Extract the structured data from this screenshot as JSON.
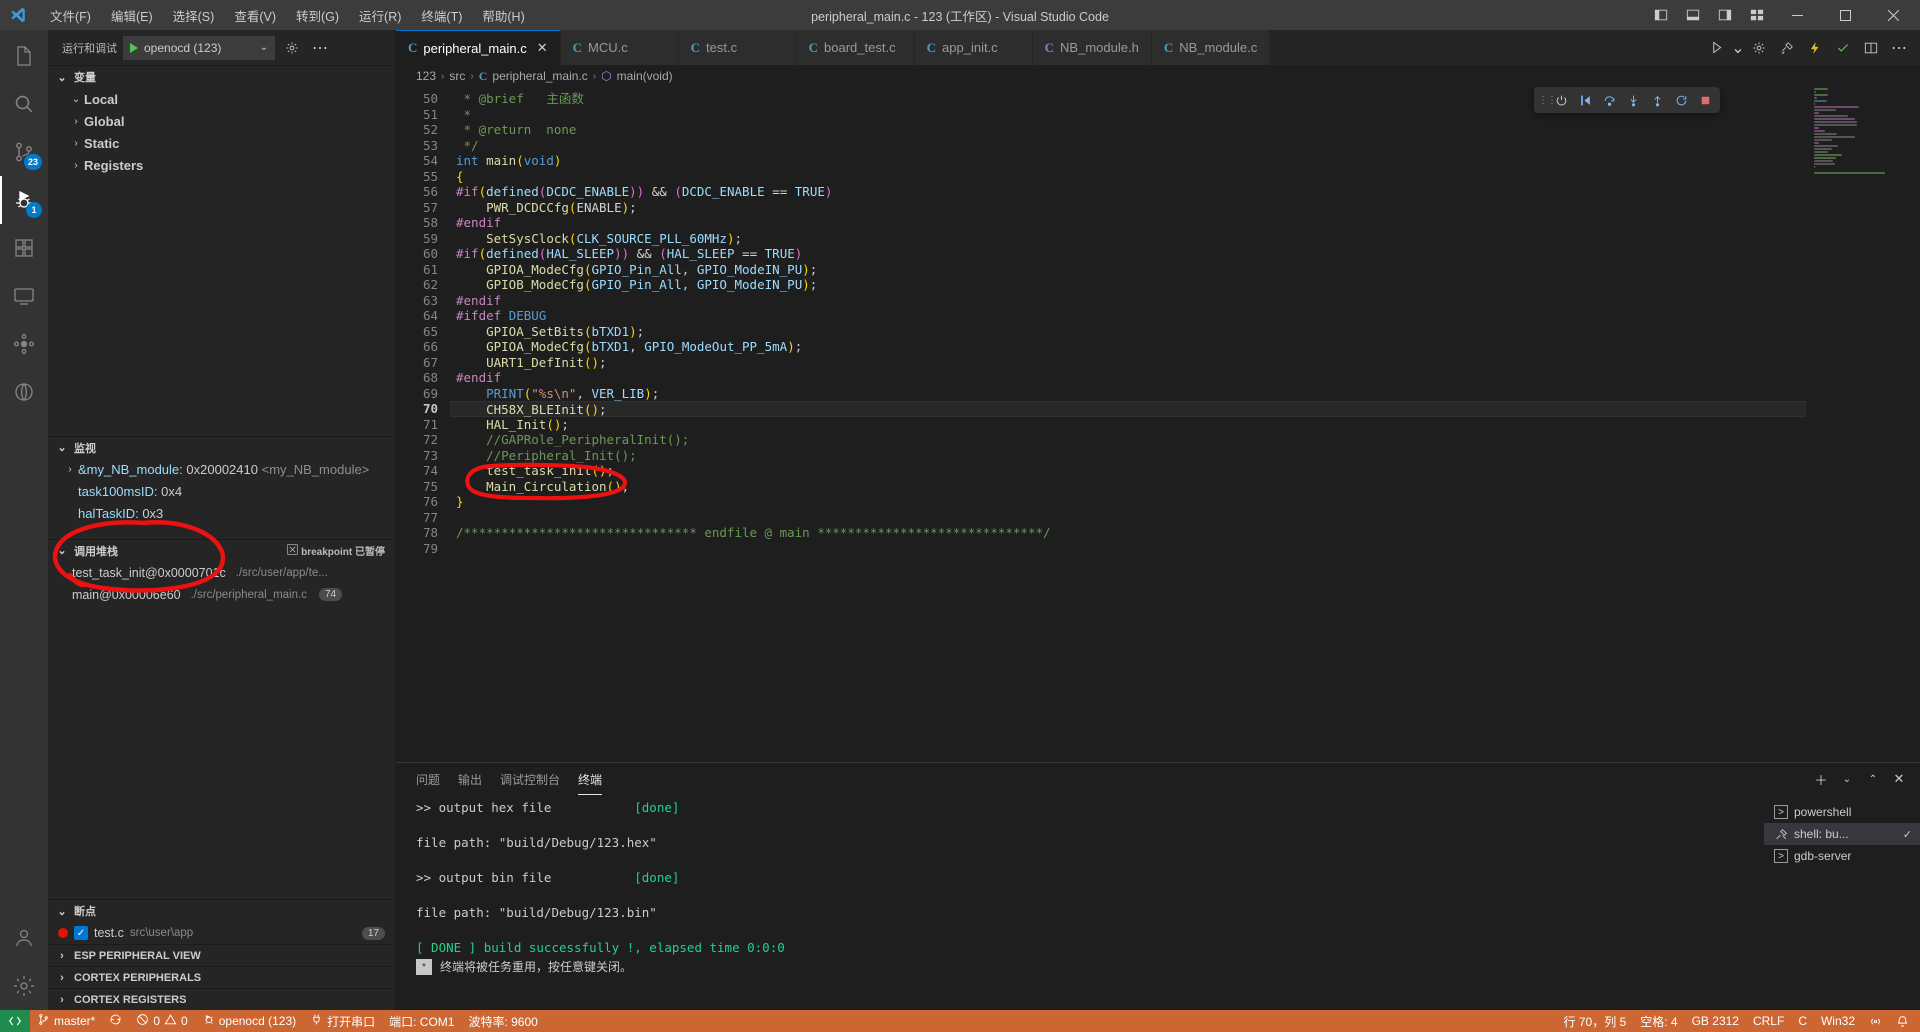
{
  "titlebar": {
    "window_title": "peripheral_main.c - 123 (工作区) - Visual Studio Code",
    "menus": [
      "文件(F)",
      "编辑(E)",
      "选择(S)",
      "查看(V)",
      "转到(G)",
      "运行(R)",
      "终端(T)",
      "帮助(H)"
    ],
    "layout_icons": [
      "panel-left-icon",
      "panel-bottom-icon",
      "panel-right-icon",
      "customize-layout-icon"
    ],
    "window_buttons": [
      "minimize",
      "maximize",
      "close"
    ]
  },
  "activitybar": {
    "items": [
      {
        "name": "explorer",
        "badge": ""
      },
      {
        "name": "search",
        "badge": ""
      },
      {
        "name": "source-control",
        "badge": "23"
      },
      {
        "name": "run-and-debug",
        "badge": "1"
      },
      {
        "name": "extensions",
        "badge": ""
      },
      {
        "name": "remote-explorer",
        "badge": ""
      },
      {
        "name": "testing",
        "badge": ""
      },
      {
        "name": "embedded-ide",
        "badge": ""
      }
    ],
    "bottom": [
      {
        "name": "accounts"
      },
      {
        "name": "settings"
      }
    ]
  },
  "sidebar": {
    "header_title": "运行和调试",
    "config_name": "openocd (123)",
    "gear_icon": "gear-icon",
    "more_icon": "ellipsis-icon",
    "variables": {
      "title": "变量",
      "items": [
        {
          "label": "Local",
          "expanded": true
        },
        {
          "label": "Global",
          "expanded": false
        },
        {
          "label": "Static",
          "expanded": false
        },
        {
          "label": "Registers",
          "expanded": false
        }
      ]
    },
    "watch": {
      "title": "监视",
      "items": [
        {
          "expandable": true,
          "name": "&my_NB_module:",
          "value": "0x20002410",
          "symbol": "<my_NB_module>"
        },
        {
          "expandable": false,
          "name": "task100msID:",
          "value": "0x4",
          "symbol": ""
        },
        {
          "expandable": false,
          "name": "halTaskID:",
          "value": "0x3",
          "symbol": ""
        }
      ]
    },
    "callstack": {
      "title": "调用堆栈",
      "status": "breakpoint 已暂停",
      "status_icon": "pause-icon",
      "frames": [
        {
          "name": "test_task_init@0x0000701c",
          "path": "./src/user/app/te...",
          "line": ""
        },
        {
          "name": "main@0x00006e60",
          "path": "./src/peripheral_main.c",
          "line": "74"
        }
      ]
    },
    "breakpoints": {
      "title": "断点",
      "items": [
        {
          "file": "test.c",
          "path": "src\\user\\app",
          "line": "17",
          "enabled": true
        }
      ]
    },
    "collapsed_panes": [
      "ESP PERIPHERAL VIEW",
      "CORTEX PERIPHERALS",
      "CORTEX REGISTERS"
    ]
  },
  "editor": {
    "tabs": [
      {
        "label": "peripheral_main.c",
        "icon": "c-file-icon",
        "active": true,
        "closable": true,
        "icon_color": "blue"
      },
      {
        "label": "MCU.c",
        "icon": "c-file-icon",
        "active": false,
        "icon_color": "blue"
      },
      {
        "label": "test.c",
        "icon": "c-file-icon",
        "active": false,
        "icon_color": "blue"
      },
      {
        "label": "board_test.c",
        "icon": "c-file-icon",
        "active": false,
        "icon_color": "blue"
      },
      {
        "label": "app_init.c",
        "icon": "c-file-icon",
        "active": false,
        "icon_color": "blue"
      },
      {
        "label": "NB_module.h",
        "icon": "c-file-icon",
        "active": false,
        "icon_color": "purple"
      },
      {
        "label": "NB_module.c",
        "icon": "c-file-icon",
        "active": false,
        "icon_color": "blue"
      }
    ],
    "tab_actions": [
      "run-debug-icon",
      "gear-icon",
      "build-icon",
      "flash-icon",
      "check-icon",
      "split-editor-icon",
      "more-actions-icon"
    ],
    "breadcrumb": [
      "123",
      "src",
      "peripheral_main.c",
      "main(void)"
    ],
    "first_line_number": 50,
    "current_line": 70,
    "lines": [
      {
        "n": 50,
        "tokens": [
          {
            "t": " * @brief   ",
            "c": "c-cmt"
          },
          {
            "t": "主函数",
            "c": "c-cmt"
          }
        ]
      },
      {
        "n": 51,
        "tokens": [
          {
            "t": " *",
            "c": "c-cmt"
          }
        ]
      },
      {
        "n": 52,
        "tokens": [
          {
            "t": " * @return  none",
            "c": "c-cmt"
          }
        ]
      },
      {
        "n": 53,
        "tokens": [
          {
            "t": " */",
            "c": "c-cmt"
          }
        ]
      },
      {
        "n": 54,
        "tokens": [
          {
            "t": "int",
            "c": "c-kw"
          },
          {
            "t": " ",
            "c": "c-plain"
          },
          {
            "t": "main",
            "c": "c-fn"
          },
          {
            "t": "(",
            "c": "c-br1"
          },
          {
            "t": "void",
            "c": "c-kw"
          },
          {
            "t": ")",
            "c": "c-br1"
          }
        ]
      },
      {
        "n": 55,
        "tokens": [
          {
            "t": "{",
            "c": "c-br1"
          }
        ]
      },
      {
        "n": 56,
        "tokens": [
          {
            "t": "#if",
            "c": "c-kw2"
          },
          {
            "t": "(",
            "c": "c-br1"
          },
          {
            "t": "defined",
            "c": "c-id"
          },
          {
            "t": "(",
            "c": "c-br2"
          },
          {
            "t": "DCDC_ENABLE",
            "c": "c-id"
          },
          {
            "t": "))",
            "c": "c-br2"
          },
          {
            "t": " ",
            "c": "c-plain"
          },
          {
            "t": "&&",
            "c": "c-op"
          },
          {
            "t": " ",
            "c": "c-plain"
          },
          {
            "t": "(",
            "c": "c-br2"
          },
          {
            "t": "DCDC_ENABLE",
            "c": "c-id"
          },
          {
            "t": " ",
            "c": "c-plain"
          },
          {
            "t": "==",
            "c": "c-op"
          },
          {
            "t": " ",
            "c": "c-plain"
          },
          {
            "t": "TRUE",
            "c": "c-id"
          },
          {
            "t": ")",
            "c": "c-br2"
          }
        ]
      },
      {
        "n": 57,
        "tokens": [
          {
            "t": "    ",
            "c": "c-plain"
          },
          {
            "t": "PWR_DCDCCfg",
            "c": "c-fn"
          },
          {
            "t": "(",
            "c": "c-br1"
          },
          {
            "t": "ENABLE",
            "c": "c-plain"
          },
          {
            "t": ")",
            "c": "c-br1"
          },
          {
            "t": ";",
            "c": "c-pun"
          }
        ]
      },
      {
        "n": 58,
        "tokens": [
          {
            "t": "#endif",
            "c": "c-kw2"
          }
        ]
      },
      {
        "n": 59,
        "tokens": [
          {
            "t": "    ",
            "c": "c-plain"
          },
          {
            "t": "SetSysClock",
            "c": "c-fn"
          },
          {
            "t": "(",
            "c": "c-br1"
          },
          {
            "t": "CLK_SOURCE_PLL_60MHz",
            "c": "c-id"
          },
          {
            "t": ")",
            "c": "c-br1"
          },
          {
            "t": ";",
            "c": "c-pun"
          }
        ]
      },
      {
        "n": 60,
        "tokens": [
          {
            "t": "#if",
            "c": "c-kw2"
          },
          {
            "t": "(",
            "c": "c-br1"
          },
          {
            "t": "defined",
            "c": "c-id"
          },
          {
            "t": "(",
            "c": "c-br2"
          },
          {
            "t": "HAL_SLEEP",
            "c": "c-id"
          },
          {
            "t": "))",
            "c": "c-br2"
          },
          {
            "t": " ",
            "c": "c-plain"
          },
          {
            "t": "&&",
            "c": "c-op"
          },
          {
            "t": " ",
            "c": "c-plain"
          },
          {
            "t": "(",
            "c": "c-br2"
          },
          {
            "t": "HAL_SLEEP",
            "c": "c-id"
          },
          {
            "t": " ",
            "c": "c-plain"
          },
          {
            "t": "==",
            "c": "c-op"
          },
          {
            "t": " ",
            "c": "c-plain"
          },
          {
            "t": "TRUE",
            "c": "c-id"
          },
          {
            "t": ")",
            "c": "c-br2"
          }
        ]
      },
      {
        "n": 61,
        "tokens": [
          {
            "t": "    ",
            "c": "c-plain"
          },
          {
            "t": "GPIOA_ModeCfg",
            "c": "c-fn"
          },
          {
            "t": "(",
            "c": "c-br1"
          },
          {
            "t": "GPIO_Pin_All",
            "c": "c-id"
          },
          {
            "t": ", ",
            "c": "c-pun"
          },
          {
            "t": "GPIO_ModeIN_PU",
            "c": "c-id"
          },
          {
            "t": ")",
            "c": "c-br1"
          },
          {
            "t": ";",
            "c": "c-pun"
          }
        ]
      },
      {
        "n": 62,
        "tokens": [
          {
            "t": "    ",
            "c": "c-plain"
          },
          {
            "t": "GPIOB_ModeCfg",
            "c": "c-fn"
          },
          {
            "t": "(",
            "c": "c-br1"
          },
          {
            "t": "GPIO_Pin_All",
            "c": "c-id"
          },
          {
            "t": ", ",
            "c": "c-pun"
          },
          {
            "t": "GPIO_ModeIN_PU",
            "c": "c-id"
          },
          {
            "t": ")",
            "c": "c-br1"
          },
          {
            "t": ";",
            "c": "c-pun"
          }
        ]
      },
      {
        "n": 63,
        "tokens": [
          {
            "t": "#endif",
            "c": "c-kw2"
          }
        ]
      },
      {
        "n": 64,
        "tokens": [
          {
            "t": "#ifdef",
            "c": "c-kw2"
          },
          {
            "t": " ",
            "c": "c-plain"
          },
          {
            "t": "DEBUG",
            "c": "c-kw"
          }
        ]
      },
      {
        "n": 65,
        "tokens": [
          {
            "t": "    ",
            "c": "c-plain"
          },
          {
            "t": "GPIOA_SetBits",
            "c": "c-fn"
          },
          {
            "t": "(",
            "c": "c-br1"
          },
          {
            "t": "bTXD1",
            "c": "c-id"
          },
          {
            "t": ")",
            "c": "c-br1"
          },
          {
            "t": ";",
            "c": "c-pun"
          }
        ]
      },
      {
        "n": 66,
        "tokens": [
          {
            "t": "    ",
            "c": "c-plain"
          },
          {
            "t": "GPIOA_ModeCfg",
            "c": "c-fn"
          },
          {
            "t": "(",
            "c": "c-br1"
          },
          {
            "t": "bTXD1",
            "c": "c-id"
          },
          {
            "t": ", ",
            "c": "c-pun"
          },
          {
            "t": "GPIO_ModeOut_PP_5mA",
            "c": "c-id"
          },
          {
            "t": ")",
            "c": "c-br1"
          },
          {
            "t": ";",
            "c": "c-pun"
          }
        ]
      },
      {
        "n": 67,
        "tokens": [
          {
            "t": "    ",
            "c": "c-plain"
          },
          {
            "t": "UART1_DefInit",
            "c": "c-fn"
          },
          {
            "t": "(",
            "c": "c-br1"
          },
          {
            "t": ")",
            "c": "c-br1"
          },
          {
            "t": ";",
            "c": "c-pun"
          }
        ]
      },
      {
        "n": 68,
        "tokens": [
          {
            "t": "#endif",
            "c": "c-kw2"
          }
        ]
      },
      {
        "n": 69,
        "tokens": [
          {
            "t": "    ",
            "c": "c-plain"
          },
          {
            "t": "PRINT",
            "c": "c-kw"
          },
          {
            "t": "(",
            "c": "c-br1"
          },
          {
            "t": "\"%s\\n\"",
            "c": "c-str"
          },
          {
            "t": ", ",
            "c": "c-pun"
          },
          {
            "t": "VER_LIB",
            "c": "c-id"
          },
          {
            "t": ")",
            "c": "c-br1"
          },
          {
            "t": ";",
            "c": "c-pun"
          }
        ]
      },
      {
        "n": 70,
        "tokens": [
          {
            "t": "    ",
            "c": "c-plain"
          },
          {
            "t": "CH58X_BLEInit",
            "c": "c-fn"
          },
          {
            "t": "(",
            "c": "c-br1"
          },
          {
            "t": ")",
            "c": "c-br1"
          },
          {
            "t": ";",
            "c": "c-pun"
          }
        ]
      },
      {
        "n": 71,
        "tokens": [
          {
            "t": "    ",
            "c": "c-plain"
          },
          {
            "t": "HAL_Init",
            "c": "c-fn"
          },
          {
            "t": "(",
            "c": "c-br1"
          },
          {
            "t": ")",
            "c": "c-br1"
          },
          {
            "t": ";",
            "c": "c-pun"
          }
        ]
      },
      {
        "n": 72,
        "tokens": [
          {
            "t": "    //GAPRole_PeripheralInit();",
            "c": "c-cmt"
          }
        ]
      },
      {
        "n": 73,
        "tokens": [
          {
            "t": "    //Peripheral_Init();",
            "c": "c-cmt"
          }
        ]
      },
      {
        "n": 74,
        "tokens": [
          {
            "t": "    ",
            "c": "c-plain"
          },
          {
            "t": "test_task_init",
            "c": "c-fn"
          },
          {
            "t": "(",
            "c": "c-br1"
          },
          {
            "t": ")",
            "c": "c-br1"
          },
          {
            "t": ";",
            "c": "c-pun"
          }
        ]
      },
      {
        "n": 75,
        "tokens": [
          {
            "t": "    ",
            "c": "c-plain"
          },
          {
            "t": "Main_Circulation",
            "c": "c-fn"
          },
          {
            "t": "(",
            "c": "c-br1"
          },
          {
            "t": ")",
            "c": "c-br1"
          },
          {
            "t": ";",
            "c": "c-pun"
          }
        ]
      },
      {
        "n": 76,
        "tokens": [
          {
            "t": "}",
            "c": "c-br1"
          }
        ]
      },
      {
        "n": 77,
        "tokens": []
      },
      {
        "n": 78,
        "tokens": [
          {
            "t": "/******************************* endfile @ main ******************************/",
            "c": "c-cmt"
          }
        ]
      },
      {
        "n": 79,
        "tokens": []
      }
    ],
    "debug_toolbar_icons": [
      "grip-icon",
      "power-icon",
      "continue-icon",
      "step-over-icon",
      "step-into-icon",
      "step-out-icon",
      "restart-icon",
      "stop-icon"
    ]
  },
  "panel": {
    "tabs": [
      "问题",
      "输出",
      "调试控制台",
      "终端"
    ],
    "active_tab": "终端",
    "actions": [
      "add-terminal-icon",
      "chevron-down-icon",
      "maximize-panel-icon",
      "close-panel-icon"
    ],
    "terminal_lines": [
      {
        "segments": [
          {
            "t": ">> output hex file           ",
            "c": ""
          },
          {
            "t": "[done]",
            "c": "t-green"
          }
        ]
      },
      {
        "segments": []
      },
      {
        "segments": [
          {
            "t": "file path: \"build/Debug/123.hex\"",
            "c": ""
          }
        ]
      },
      {
        "segments": []
      },
      {
        "segments": [
          {
            "t": ">> output bin file           ",
            "c": ""
          },
          {
            "t": "[done]",
            "c": "t-green"
          }
        ]
      },
      {
        "segments": []
      },
      {
        "segments": [
          {
            "t": "file path: \"build/Debug/123.bin\"",
            "c": ""
          }
        ]
      },
      {
        "segments": []
      },
      {
        "segments": [
          {
            "t": "[ DONE ] build successfully !, elapsed time 0:0:0",
            "c": "t-green"
          }
        ]
      }
    ],
    "terminal_note": "终端将被任务重用，按任意键关闭。",
    "terminal_list": [
      {
        "name": "powershell",
        "icon": "terminal-icon",
        "active": false,
        "checked": false
      },
      {
        "name": "shell: bu...",
        "icon": "tools-icon",
        "active": true,
        "checked": true
      },
      {
        "name": "gdb-server",
        "icon": "terminal-icon",
        "active": false,
        "checked": false
      }
    ]
  },
  "statusbar": {
    "remote_icon": "remote-icon",
    "left": [
      {
        "name": "branch",
        "icon": "git-branch-icon",
        "label": "master*"
      },
      {
        "name": "sync",
        "icon": "sync-icon",
        "label": ""
      },
      {
        "name": "problems",
        "icon": "error-warning-icon",
        "label": "0  0"
      },
      {
        "name": "debug-config",
        "icon": "debug-icon",
        "label": "openocd (123)"
      },
      {
        "name": "open-serial",
        "icon": "plug-icon",
        "label": "打开串口"
      },
      {
        "name": "serial-port",
        "icon": "",
        "label": "端口: COM1"
      },
      {
        "name": "baud-rate",
        "icon": "",
        "label": "波特率: 9600"
      }
    ],
    "right": [
      {
        "name": "cursor-position",
        "label": "行 70，列 5"
      },
      {
        "name": "indentation",
        "label": "空格: 4"
      },
      {
        "name": "encoding",
        "label": "GB 2312"
      },
      {
        "name": "eol",
        "label": "CRLF"
      },
      {
        "name": "language-mode",
        "label": "C"
      },
      {
        "name": "platform",
        "label": "Win32"
      },
      {
        "name": "broadcast",
        "label": ""
      },
      {
        "name": "notifications",
        "label": ""
      }
    ]
  },
  "annotations": {
    "code_circle": "red-ellipse-around-CH58X_BLEInit",
    "watch_circle": "red-ellipse-around-task-ids",
    "color": "#ee1111"
  }
}
